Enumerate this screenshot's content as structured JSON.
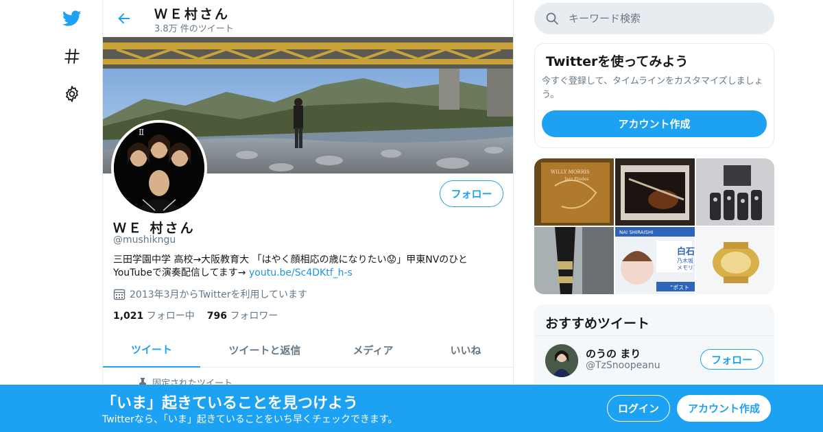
{
  "nav": {
    "items": [
      {
        "icon": "twitter-bird-icon"
      },
      {
        "icon": "hashtag-icon"
      },
      {
        "icon": "gear-icon"
      }
    ],
    "accent": "#1da1f2"
  },
  "header": {
    "name": "ＷＥ村さん",
    "tweet_count": "3.8万 件のツイート"
  },
  "profile": {
    "name": "ＷＥ 村さん",
    "handle": "@mushikngu",
    "follow_label": "フォロー",
    "bio_text": "三田学園中学 高校→大阪教育大 「はやく顔相応の歳になりたい😟」甲東NVのひと YouTubeで演奏配信してます→ ",
    "bio_link": "youtu.be/Sc4DKtf_h-s",
    "joined": "2013年3月からTwitterを利用しています",
    "following_count": "1,021",
    "following_label": "フォロー中",
    "followers_count": "796",
    "followers_label": "フォロワー"
  },
  "tabs": [
    {
      "label": "ツイート",
      "active": true
    },
    {
      "label": "ツイートと返信",
      "active": false
    },
    {
      "label": "メディア",
      "active": false
    },
    {
      "label": "いいね",
      "active": false
    }
  ],
  "pinned_label": "固定されたツイート",
  "search": {
    "placeholder": "キーワード検索"
  },
  "signup_card": {
    "title": "Twitterを使ってみよう",
    "description": "今すぐ登録して、タイムラインをカスタマイズしましょう。",
    "button": "アカウント作成"
  },
  "media_tiles": [
    {
      "label": "WILLY MORRIS",
      "sub": "Jazz Etudes"
    },
    {
      "label": ""
    },
    {
      "label": ""
    },
    {
      "label": ""
    },
    {
      "label": "NAI SHIRAISHI",
      "sub": "白石",
      "sub2": "乃木坂",
      "sub3": "メモリア",
      "sub4": "“ポスト"
    },
    {
      "label": ""
    }
  ],
  "recommended": {
    "title": "おすすめツイート",
    "users": [
      {
        "name": "のうの まり",
        "handle": "@TzSnoopeanu",
        "follow_label": "フォロー"
      }
    ]
  },
  "bottom_bar": {
    "title": "「いま」起きていることを見つけよう",
    "subtitle": "Twitterなら、「いま」起きていることをいち早くチェックできます。",
    "login": "ログイン",
    "signup": "アカウント作成"
  }
}
